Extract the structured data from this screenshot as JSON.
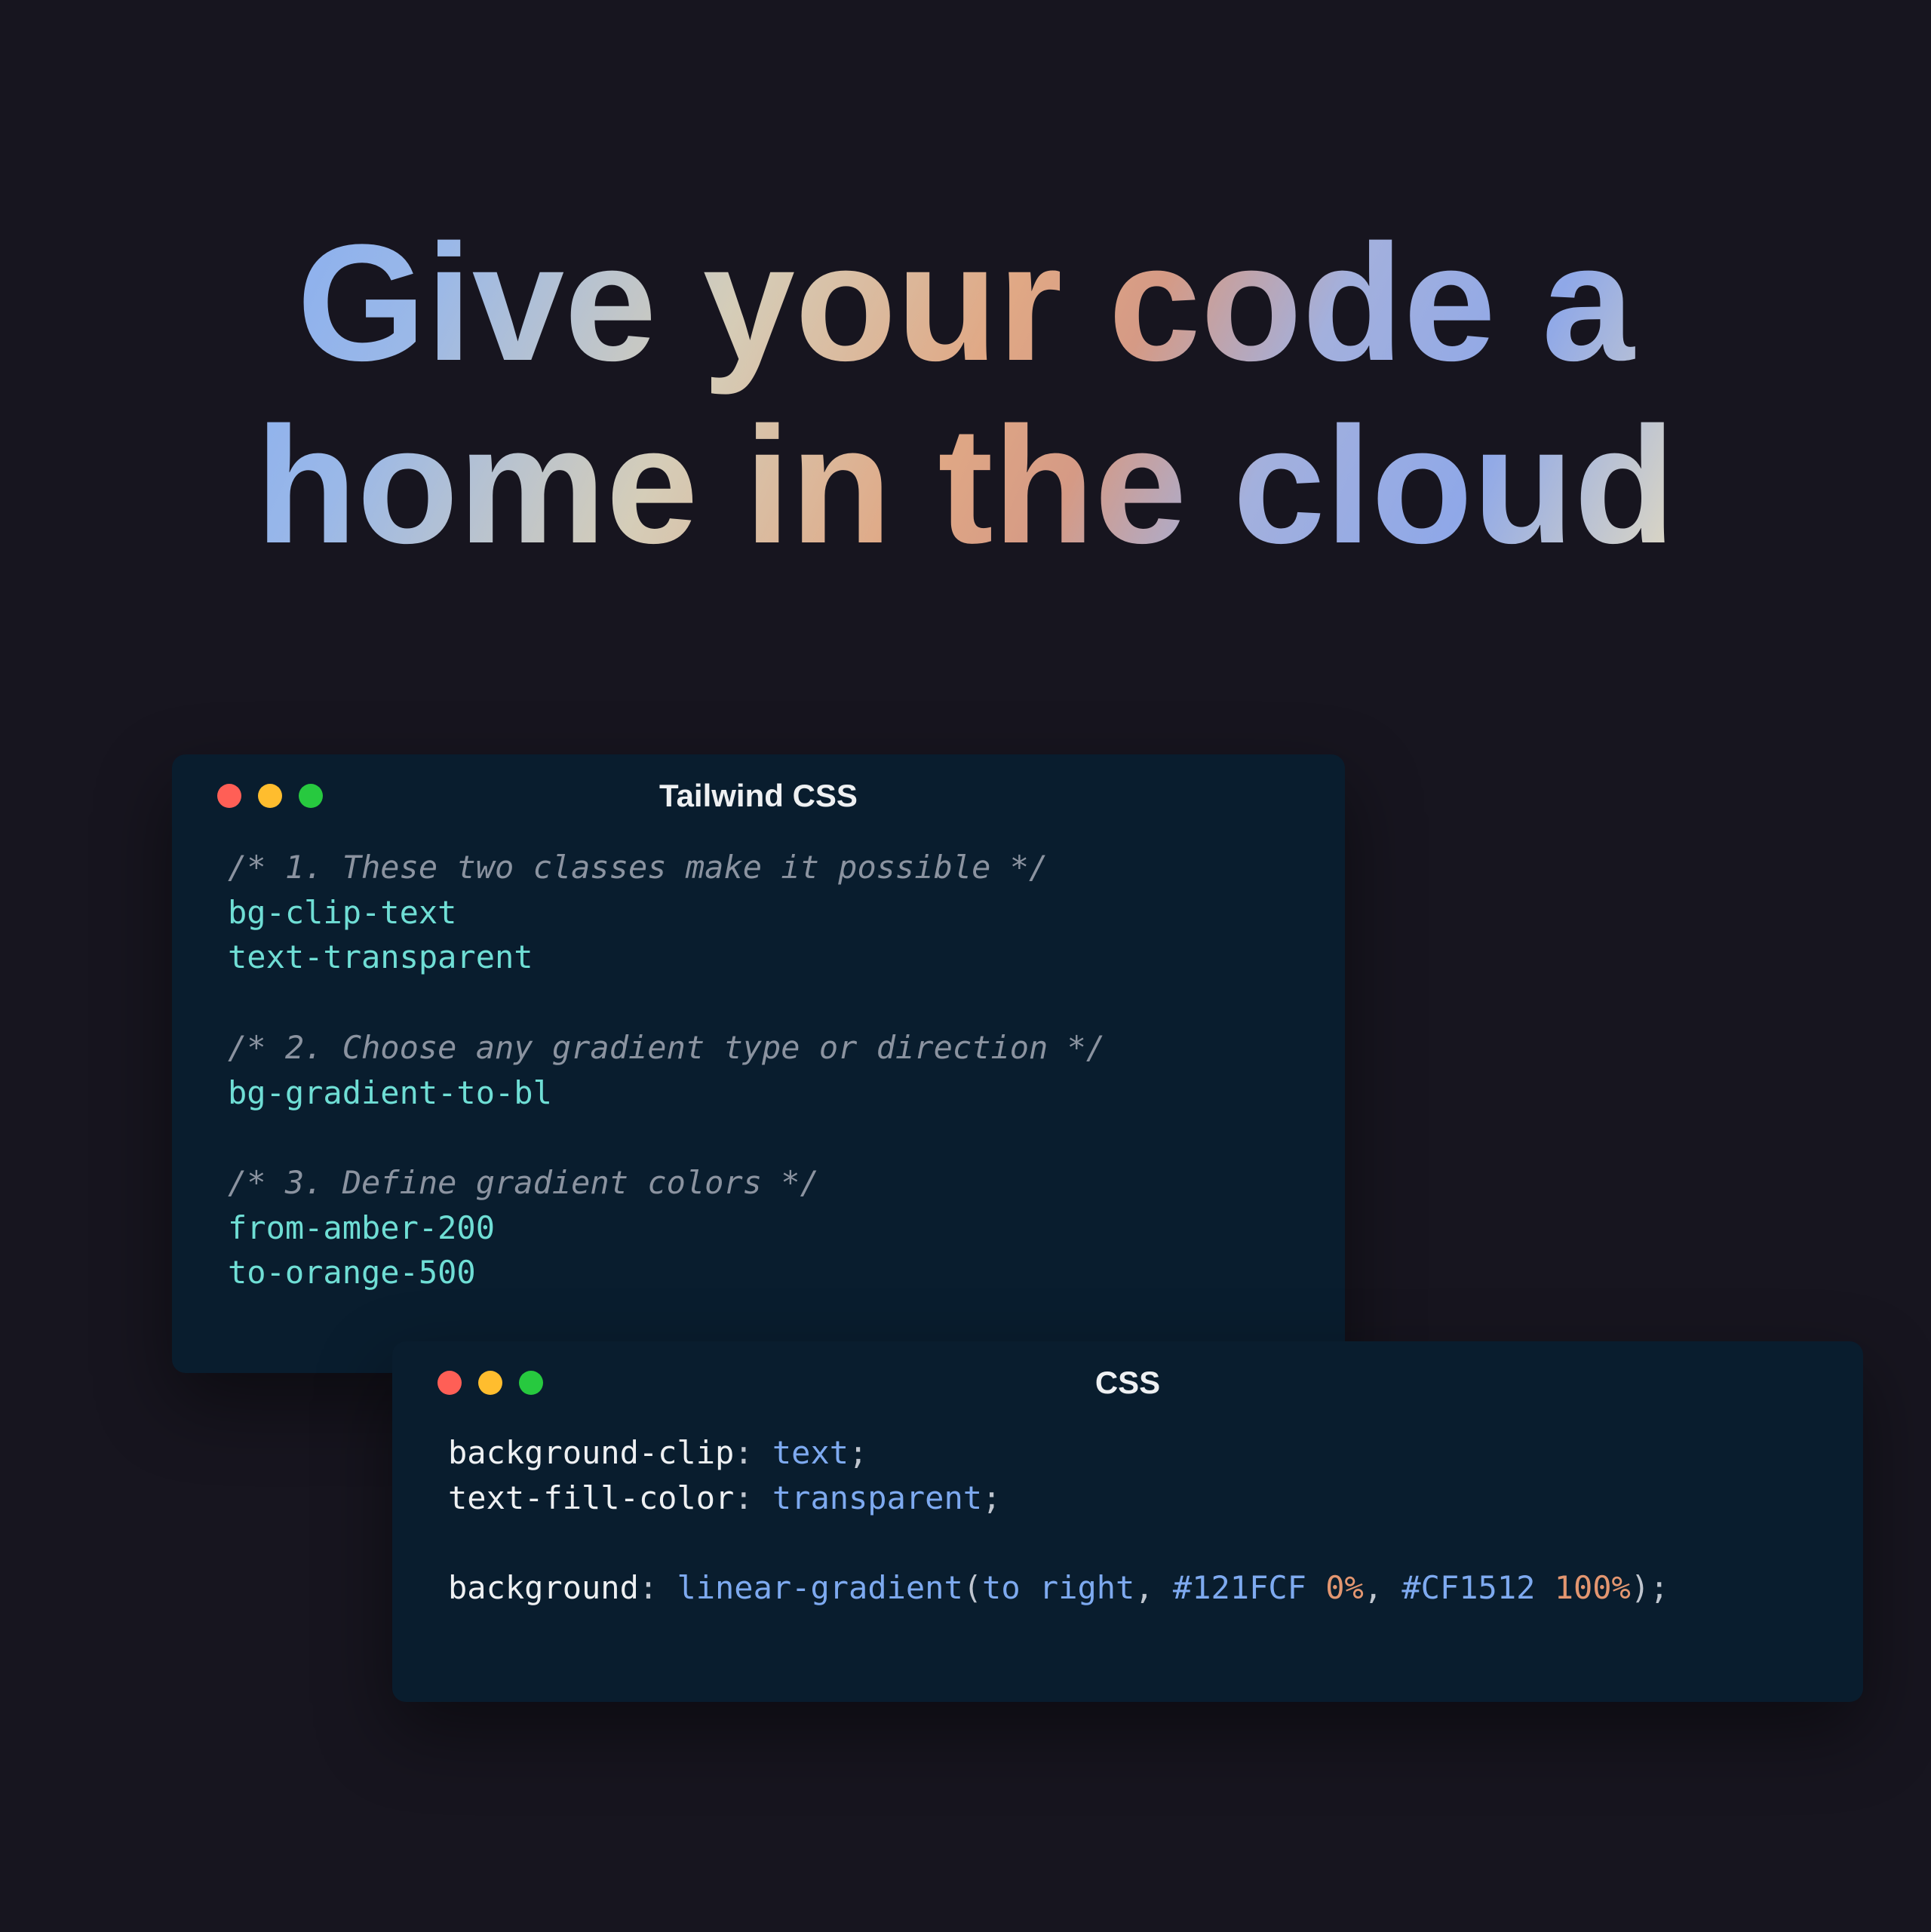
{
  "hero": {
    "title": "Give your code a home in the cloud"
  },
  "windows": {
    "tailwind": {
      "title": "Tailwind CSS",
      "comment1": "/* 1. These two classes make it possible */",
      "class1": "bg-clip-text",
      "class2": "text-transparent",
      "comment2": "/* 2. Choose any gradient type or direction */",
      "class3": "bg-gradient-to-bl",
      "comment3": "/* 3. Define gradient colors */",
      "class4": "from-amber-200",
      "class5": "to-orange-500"
    },
    "css": {
      "title": "CSS",
      "line1": {
        "prop": "background-clip",
        "value": "text"
      },
      "line2": {
        "prop": "text-fill-color",
        "value": "transparent"
      },
      "line3": {
        "prop": "background",
        "fn": "linear-gradient",
        "dir": "to right",
        "stop1_hex": "#121FCF",
        "stop1_pct": "0%",
        "stop2_hex": "#CF1512",
        "stop2_pct": "100%"
      }
    }
  },
  "colors": {
    "background": "#17151f",
    "window_bg": "#091d2e",
    "traffic_red": "#ff5f56",
    "traffic_yellow": "#ffbd2e",
    "traffic_green": "#27c93f"
  }
}
